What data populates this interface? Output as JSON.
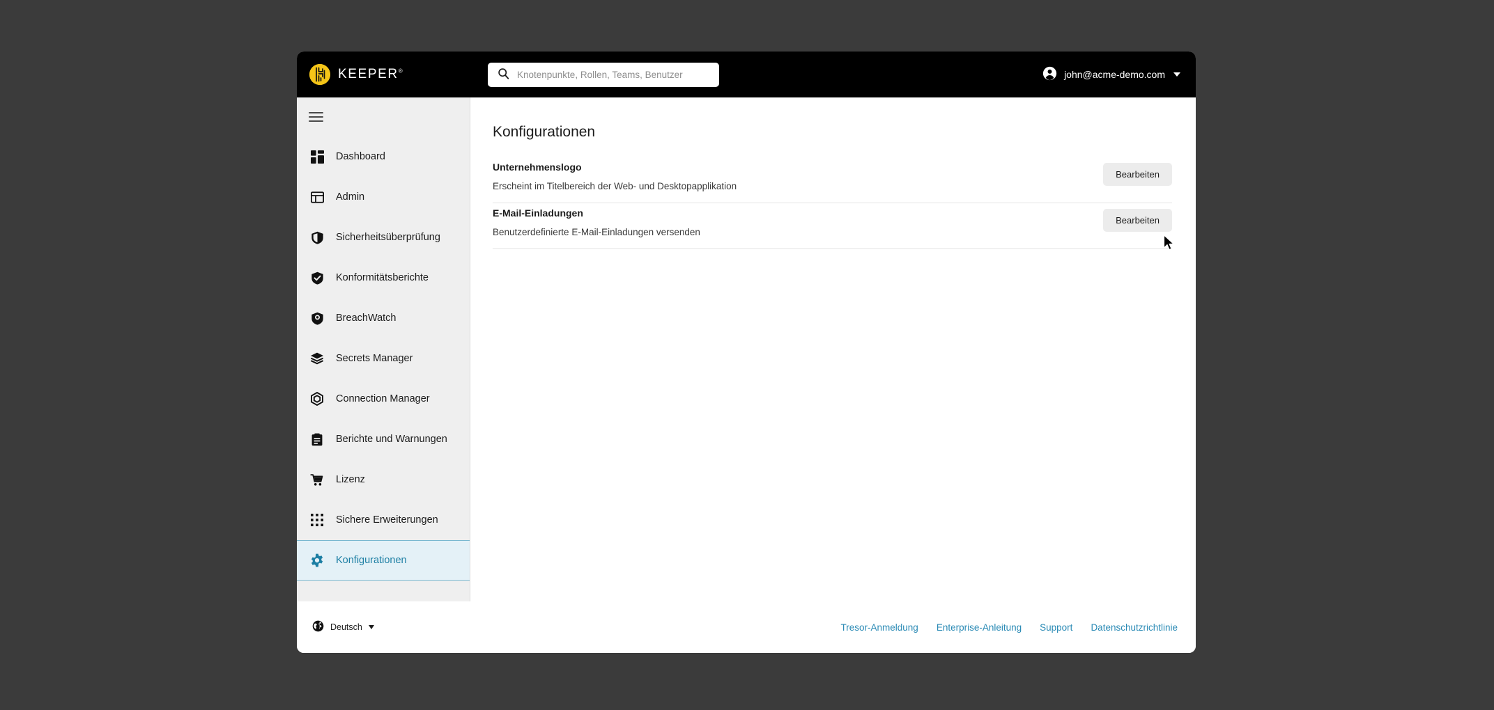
{
  "window": {
    "title": "Keeper Admin Console"
  },
  "topbar": {
    "brand_name": "KEEPER",
    "brand_mark": "keeper-logo-icon",
    "registered_mark": "®",
    "search": {
      "placeholder": "Knotenpunkte, Rollen, Teams, Benutzer",
      "value": "",
      "icon": "search-icon"
    },
    "account": {
      "email": "john@acme-demo.com",
      "avatar_icon": "account-circle-icon",
      "caret_icon": "chevron-down-icon"
    }
  },
  "sidebar": {
    "menu_toggle_icon": "hamburger-menu-icon",
    "items": [
      {
        "label": "Dashboard",
        "icon": "dashboard-grid-icon",
        "active": false
      },
      {
        "label": "Admin",
        "icon": "admin-panel-icon",
        "active": false
      },
      {
        "label": "Sicherheitsüberprüfung",
        "icon": "shield-half-icon",
        "active": false
      },
      {
        "label": "Konformitätsberichte",
        "icon": "shield-check-icon",
        "active": false
      },
      {
        "label": "BreachWatch",
        "icon": "shield-eye-icon",
        "active": false
      },
      {
        "label": "Secrets Manager",
        "icon": "layers-icon",
        "active": false
      },
      {
        "label": "Connection Manager",
        "icon": "hexagon-connection-icon",
        "active": false
      },
      {
        "label": "Berichte und Warnungen",
        "icon": "clipboard-report-icon",
        "active": false
      },
      {
        "label": "Lizenz",
        "icon": "shopping-cart-icon",
        "active": false
      },
      {
        "label": "Sichere Erweiterungen",
        "icon": "apps-grid-icon",
        "active": false
      },
      {
        "label": "Konfigurationen",
        "icon": "gear-icon",
        "active": true
      }
    ]
  },
  "main": {
    "page_title": "Konfigurationen",
    "settings": [
      {
        "label": "Unternehmenslogo",
        "description": "Erscheint im Titelbereich der Web- und Desktopapplikation",
        "action_label": "Bearbeiten"
      },
      {
        "label": "E-Mail-Einladungen",
        "description": "Benutzerdefinierte E-Mail-Einladungen versenden",
        "action_label": "Bearbeiten"
      }
    ]
  },
  "footer": {
    "language": {
      "label": "Deutsch",
      "icon": "globe-icon",
      "caret_icon": "chevron-down-icon"
    },
    "links": [
      {
        "label": "Tresor-Anmeldung"
      },
      {
        "label": "Enterprise-Anleitung"
      },
      {
        "label": "Support"
      },
      {
        "label": "Datenschutzrichtlinie"
      }
    ]
  },
  "colors": {
    "accent_blue": "#1b7ea3",
    "active_bg": "#e4f1f7",
    "brand_yellow": "#f5c518",
    "topbar_bg": "#000000",
    "sidebar_bg": "#efefef",
    "desktop_bg": "#3b3b3b",
    "link_blue": "#2a8ab5"
  }
}
